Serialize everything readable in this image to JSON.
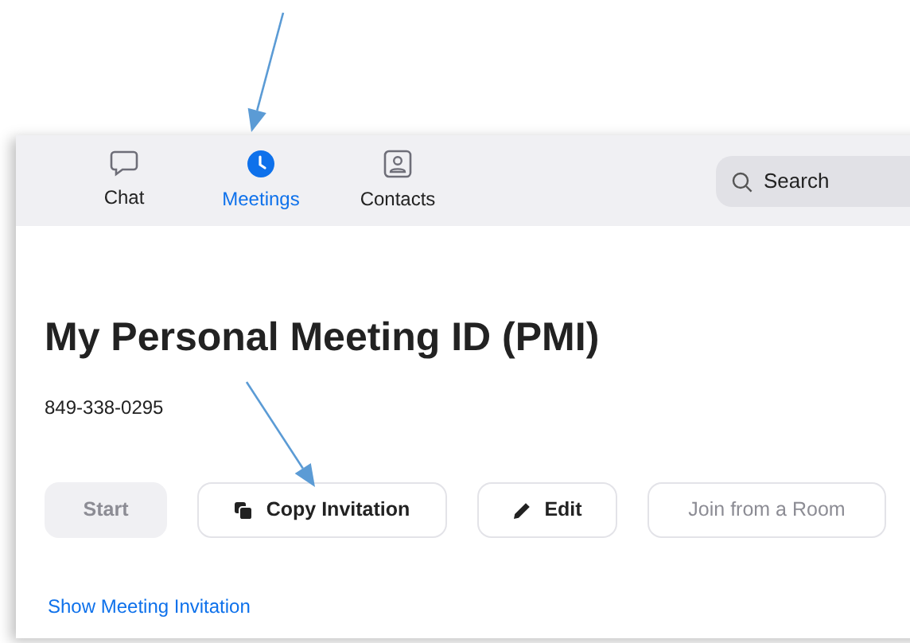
{
  "tabs": [
    {
      "label": "Chat",
      "selected": false
    },
    {
      "label": "Meetings",
      "selected": true
    },
    {
      "label": "Contacts",
      "selected": false
    }
  ],
  "search": {
    "placeholder": "Search"
  },
  "title": "My Personal Meeting ID (PMI)",
  "meeting_id": "849-338-0295",
  "buttons": [
    {
      "label": "Start",
      "disabled": true,
      "kind": "filled"
    },
    {
      "label": "Copy Invitation",
      "disabled": false,
      "kind": "outline"
    },
    {
      "label": "Edit",
      "disabled": false,
      "kind": "outline"
    },
    {
      "label": "Join from a Room",
      "disabled": true,
      "kind": "outline"
    }
  ],
  "link": "Show Meeting Invitation"
}
